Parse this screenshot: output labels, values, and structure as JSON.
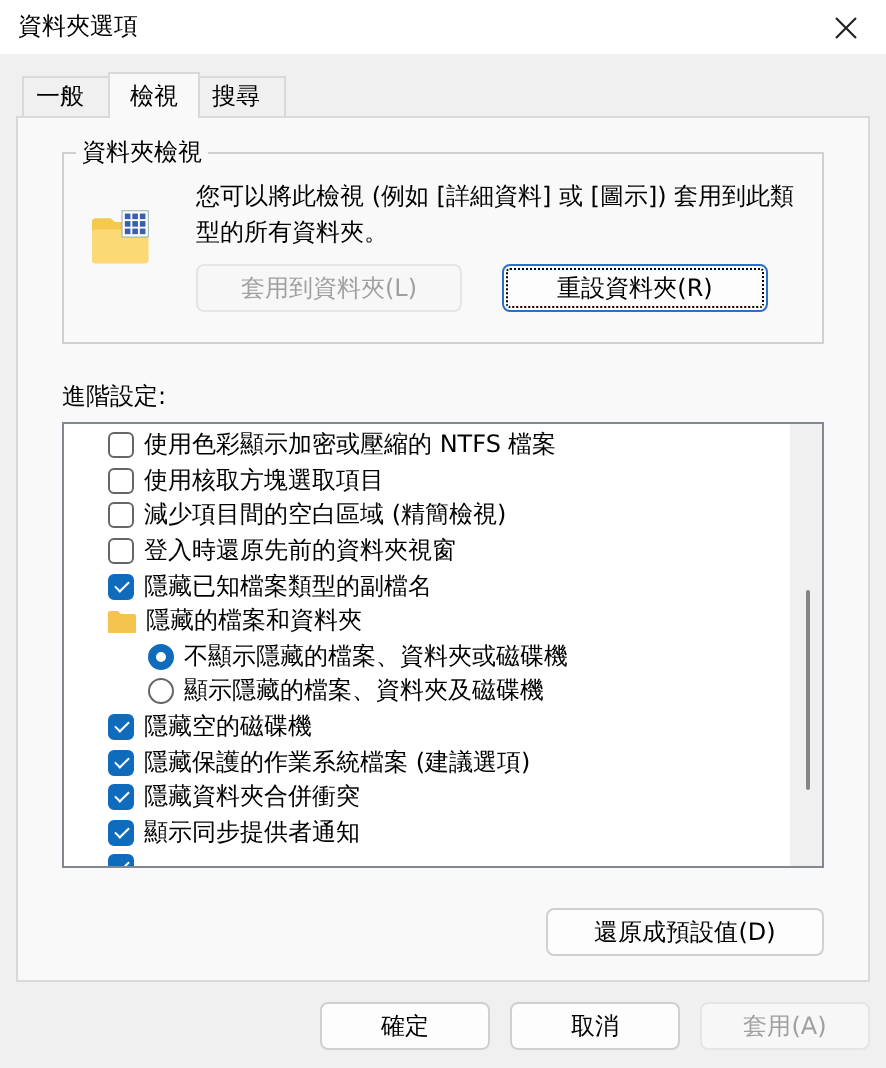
{
  "window": {
    "title": "資料夾選項"
  },
  "tabs": [
    {
      "label": "一般",
      "selected": false
    },
    {
      "label": "檢視",
      "selected": true
    },
    {
      "label": "搜尋",
      "selected": false
    }
  ],
  "folder_views": {
    "title": "資料夾檢視",
    "description": "您可以將此檢視 (例如 [詳細資料] 或 [圖示]) 套用到此類型的所有資料夾。",
    "buttons": [
      {
        "label": "套用到資料夾(L)",
        "disabled": true,
        "focused": false
      },
      {
        "label": "重設資料夾(R)",
        "disabled": false,
        "focused": true
      }
    ]
  },
  "advanced": {
    "label": "進階設定:",
    "items": [
      {
        "kind": "checkbox",
        "label": "使用色彩顯示加密或壓縮的 NTFS 檔案",
        "checked": false
      },
      {
        "kind": "checkbox",
        "label": "使用核取方塊選取項目",
        "checked": false
      },
      {
        "kind": "checkbox",
        "label": "減少項目間的空白區域 (精簡檢視)",
        "checked": false
      },
      {
        "kind": "checkbox",
        "label": "登入時還原先前的資料夾視窗",
        "checked": false
      },
      {
        "kind": "checkbox",
        "label": "隱藏已知檔案類型的副檔名",
        "checked": true
      },
      {
        "kind": "folder",
        "label": "隱藏的檔案和資料夾",
        "children": [
          {
            "kind": "radio",
            "label": "不顯示隱藏的檔案、資料夾或磁碟機",
            "selected": true
          },
          {
            "kind": "radio",
            "label": "顯示隱藏的檔案、資料夾及磁碟機",
            "selected": false
          }
        ]
      },
      {
        "kind": "checkbox",
        "label": "隱藏空的磁碟機",
        "checked": true
      },
      {
        "kind": "checkbox",
        "label": "隱藏保護的作業系統檔案 (建議選項)",
        "checked": true
      },
      {
        "kind": "checkbox",
        "label": "隱藏資料夾合併衝突",
        "checked": true
      },
      {
        "kind": "checkbox",
        "label": "顯示同步提供者通知",
        "checked": true
      },
      {
        "kind": "checkbox",
        "checked": true
      }
    ]
  },
  "restore_button": "還原成預設值(D)",
  "buttons": [
    {
      "label": "確定",
      "disabled": false
    },
    {
      "label": "取消",
      "disabled": false
    },
    {
      "label": "套用(A)",
      "disabled": true
    }
  ]
}
